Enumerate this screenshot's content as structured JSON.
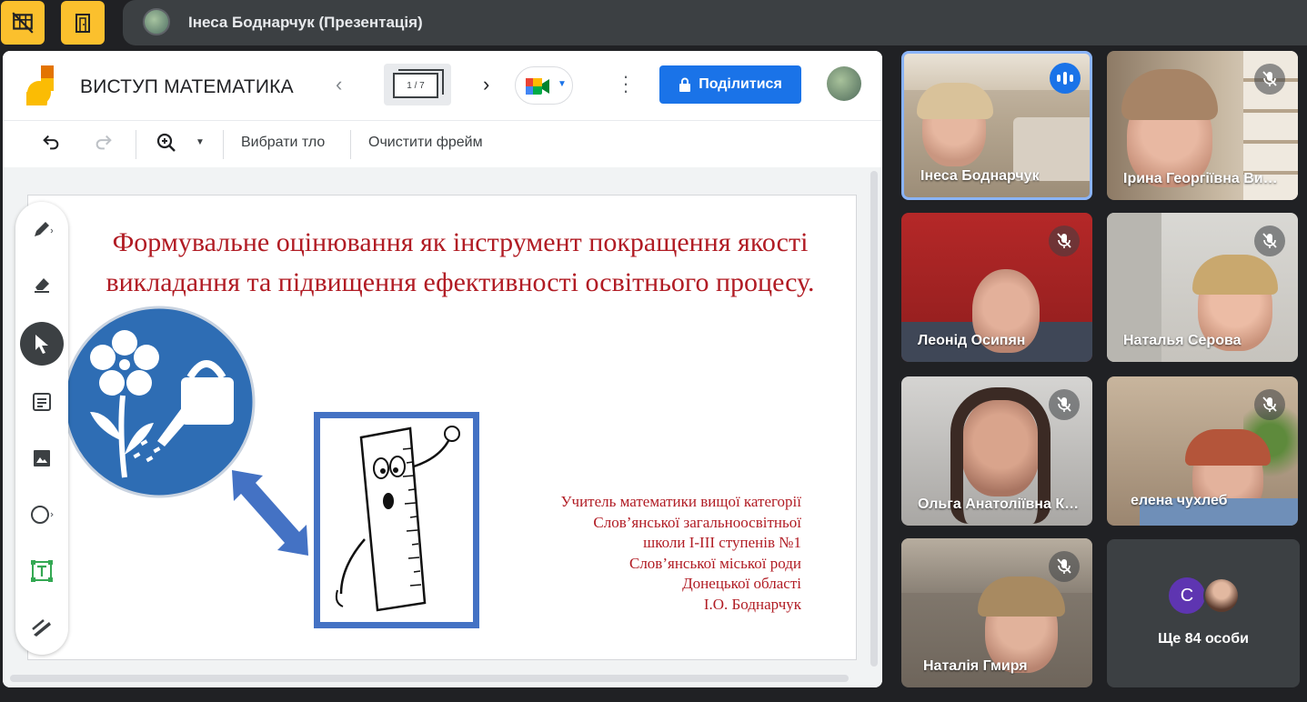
{
  "meet": {
    "presenter_label": "Інеса Боднарчук (Презентація)"
  },
  "jamboard": {
    "title": "ВИСТУП МАТЕМАТИКА",
    "frame_counter": "1 / 7",
    "share_label": "Поділитися",
    "toolbar": {
      "set_background": "Вибрати тло",
      "clear_frame": "Очистити фрейм"
    },
    "slide": {
      "title": "Формувальне оцінювання  як інструмент   покращення якості викладання та підвищення ефективності освітнього процесу.",
      "author_lines": [
        "Учитель математики вищої категорії",
        "Слов’янської загальноосвітньої",
        "школи І-ІІІ  ступенів №1",
        "Слов’янської міської роди",
        "Донецької області",
        "І.О. Боднарчук"
      ]
    }
  },
  "participants": [
    {
      "name": "Інеса Боднарчук",
      "speaking": true
    },
    {
      "name": "Ірина Георгіївна Вишнякова",
      "muted": true
    },
    {
      "name": "Леонід Осипян",
      "muted": true
    },
    {
      "name": "Наталья Серова",
      "muted": true
    },
    {
      "name": "Ольга Анатоліївна Коваленко",
      "muted": true
    },
    {
      "name": "елена чухлеб",
      "muted": true
    },
    {
      "name": "Наталія Гмиря",
      "muted": true
    }
  ],
  "more_participants": {
    "initial": "С",
    "label": "Ще 84 особи"
  },
  "colors": {
    "meet_background": "#202124",
    "accent_yellow": "#fbc02d",
    "share_blue": "#1a73e8",
    "slide_red": "#b11c24",
    "slide_blue": "#2e6db4"
  }
}
